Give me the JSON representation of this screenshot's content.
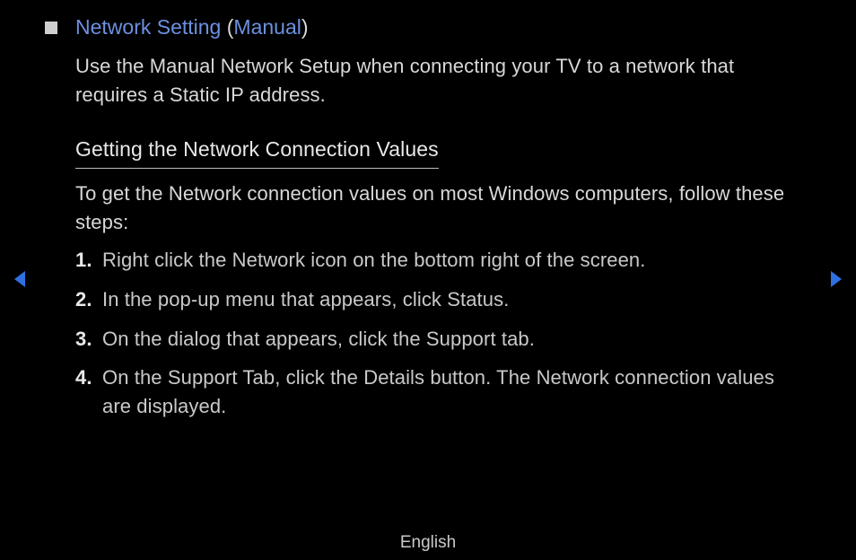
{
  "title": {
    "main": "Network Setting",
    "openParen": " (",
    "mode": "Manual",
    "closeParen": ")"
  },
  "intro": "Use the Manual Network Setup when connecting your TV to a network that requires a Static IP address.",
  "subheading": "Getting the Network Connection Values",
  "stepsIntro": "To get the Network connection values on most Windows computers, follow these steps:",
  "steps": [
    "Right click the Network icon on the bottom right of the screen.",
    "In the pop-up menu that appears, click Status.",
    "On the dialog that appears, click the Support tab.",
    "On the Support Tab, click the Details button. The Network connection values are displayed."
  ],
  "footer": "English",
  "colors": {
    "accent": "#6d91e0",
    "navArrow": "#2f6fe0"
  }
}
